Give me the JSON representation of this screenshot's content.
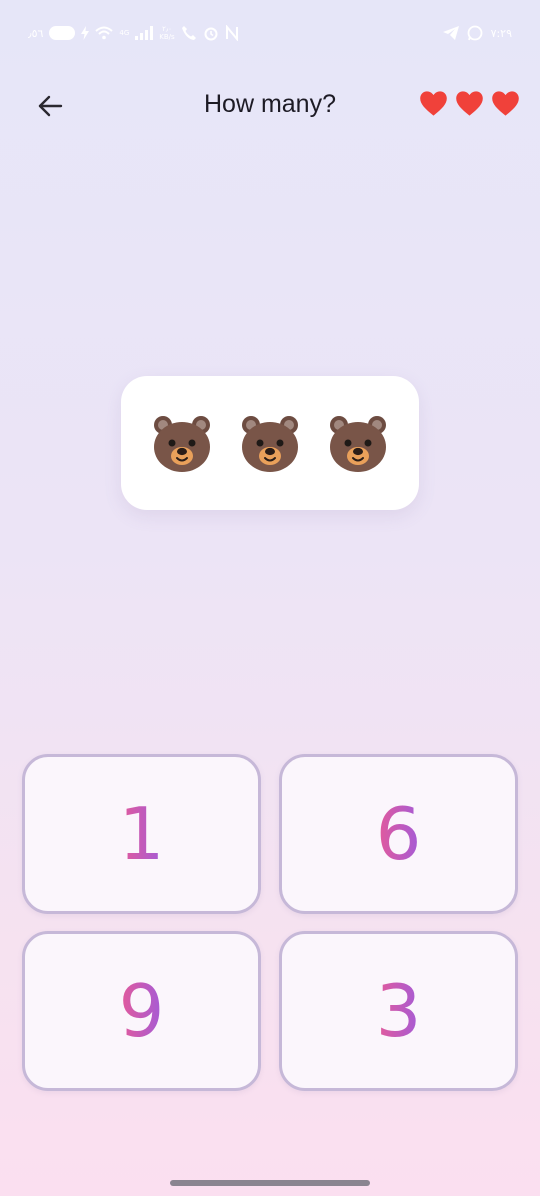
{
  "status_bar": {
    "left_text": "٫٥٦",
    "network_speed": "٢٫٠\nKB/s",
    "network_type": "4G",
    "time": "٧:٢٩"
  },
  "header": {
    "title": "How many?",
    "lives": 3,
    "heart_color": "#f0413a"
  },
  "question": {
    "item_icon": "bear-face",
    "item_count": 3
  },
  "answers": [
    {
      "label": "1"
    },
    {
      "label": "6"
    },
    {
      "label": "9"
    },
    {
      "label": "3"
    }
  ],
  "colors": {
    "answer_gradient_start": "#e45a9a",
    "answer_gradient_end": "#a35bd8",
    "button_border": "#c6b8d8"
  }
}
